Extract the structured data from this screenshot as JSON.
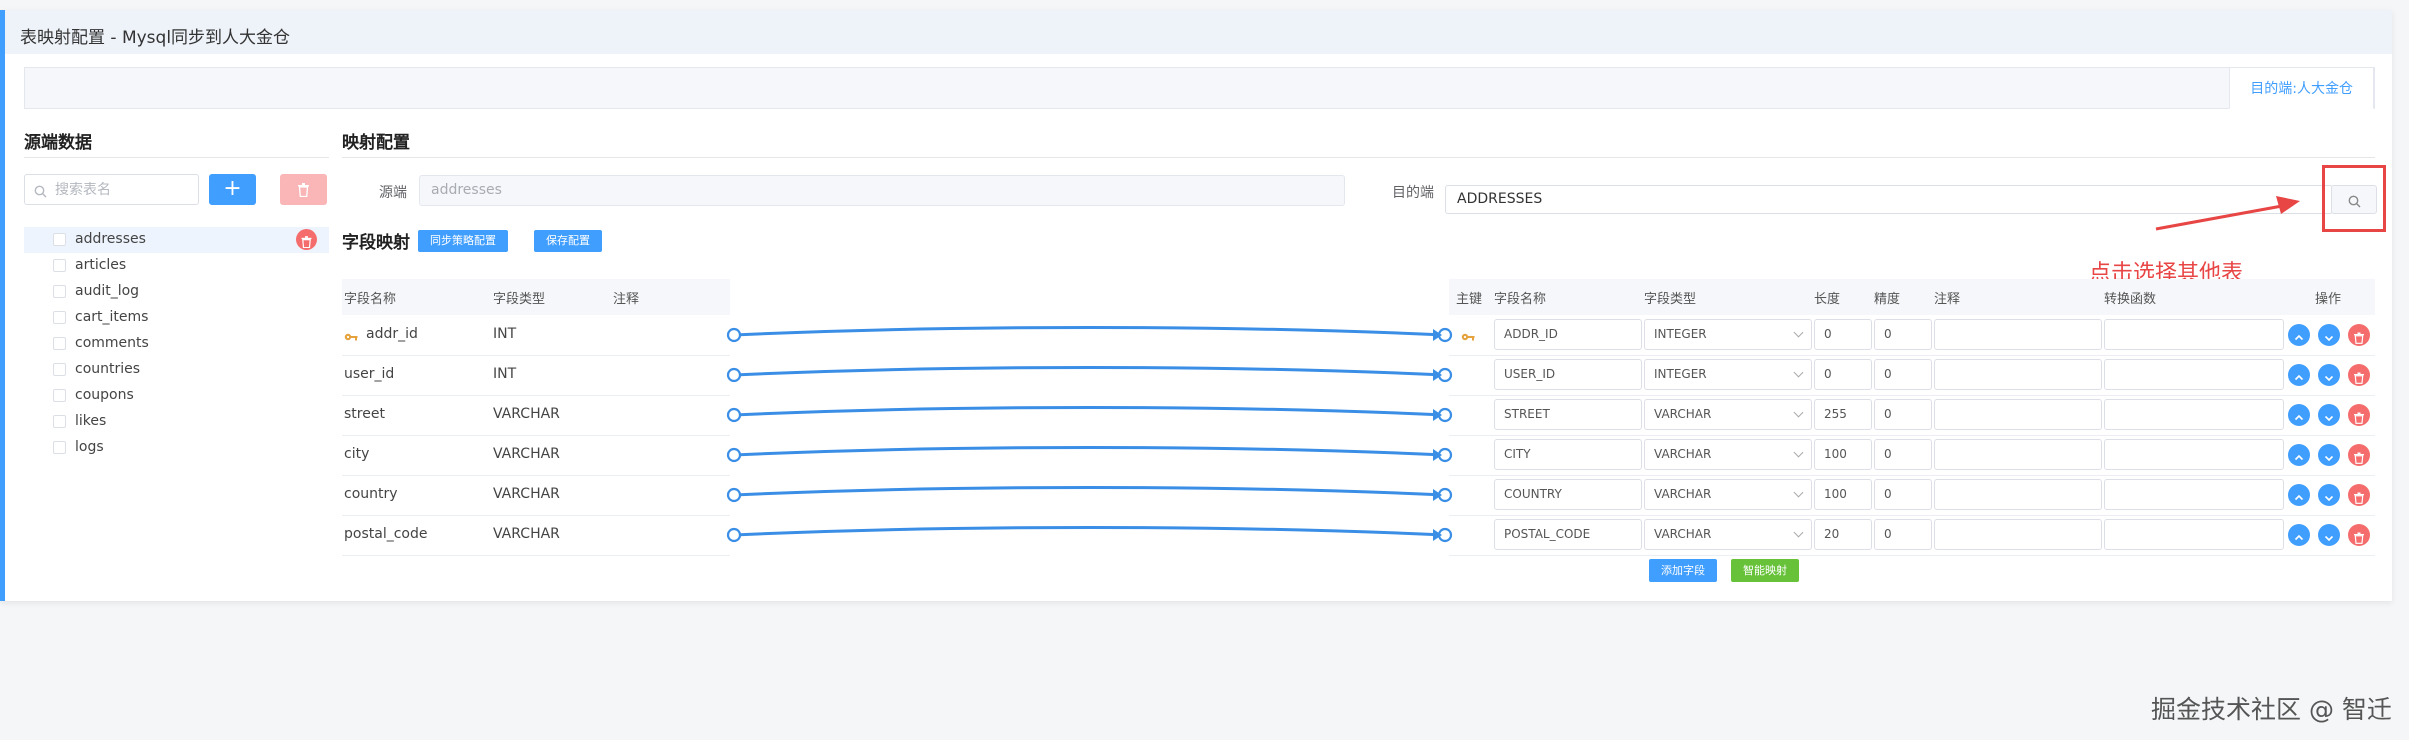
{
  "panel": {
    "title": "表映射配置 - Mysql同步到人大金仓"
  },
  "tabs": [
    {
      "label": "目的端:人大金仓"
    }
  ],
  "source_panel": {
    "title": "源端数据",
    "search_placeholder": "搜索表名",
    "add_label": "+",
    "tables": [
      "addresses",
      "articles",
      "audit_log",
      "cart_items",
      "comments",
      "countries",
      "coupons",
      "likes",
      "logs"
    ],
    "selected_index": 0
  },
  "mapping": {
    "title": "映射配置",
    "source_label": "源端",
    "source_value": "addresses",
    "target_label": "目的端",
    "target_value": "ADDRESSES"
  },
  "annotation": {
    "text": "点击选择其他表",
    "color": "#e84545"
  },
  "field_mapping": {
    "title": "字段映射",
    "sync_strategy_label": "同步策略配置",
    "save_label": "保存配置",
    "source_headers": [
      "字段名称",
      "字段类型",
      "注释"
    ],
    "target_headers": [
      "主键",
      "字段名称",
      "字段类型",
      "长度",
      "精度",
      "注释",
      "转换函数",
      "操作"
    ],
    "source_fields": [
      {
        "name": "addr_id",
        "type": "INT",
        "key": true
      },
      {
        "name": "user_id",
        "type": "INT",
        "key": false
      },
      {
        "name": "street",
        "type": "VARCHAR",
        "key": false
      },
      {
        "name": "city",
        "type": "VARCHAR",
        "key": false
      },
      {
        "name": "country",
        "type": "VARCHAR",
        "key": false
      },
      {
        "name": "postal_code",
        "type": "VARCHAR",
        "key": false
      }
    ],
    "target_fields": [
      {
        "name": "ADDR_ID",
        "type": "INTEGER",
        "length": "0",
        "precision": "0",
        "key": true
      },
      {
        "name": "USER_ID",
        "type": "INTEGER",
        "length": "0",
        "precision": "0",
        "key": false
      },
      {
        "name": "STREET",
        "type": "VARCHAR",
        "length": "255",
        "precision": "0",
        "key": false
      },
      {
        "name": "CITY",
        "type": "VARCHAR",
        "length": "100",
        "precision": "0",
        "key": false
      },
      {
        "name": "COUNTRY",
        "type": "VARCHAR",
        "length": "100",
        "precision": "0",
        "key": false
      },
      {
        "name": "POSTAL_CODE",
        "type": "VARCHAR",
        "length": "20",
        "precision": "0",
        "key": false
      }
    ],
    "add_field_label": "添加字段",
    "smart_map_label": "智能映射"
  },
  "watermark": "掘金技术社区 @ 智迁",
  "colors": {
    "primary": "#409eff",
    "danger": "#f56c6c",
    "success": "#67c23a",
    "link": "#3a8ee6",
    "annotation": "#e84545"
  }
}
